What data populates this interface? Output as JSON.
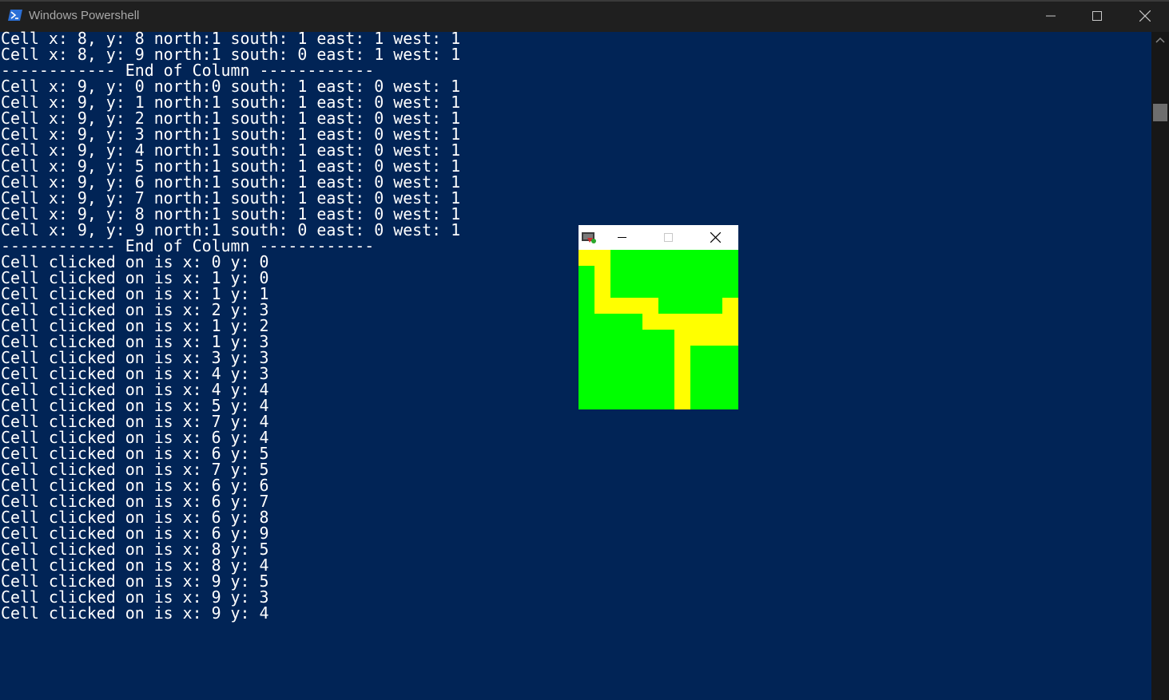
{
  "window": {
    "title": "Windows Powershell"
  },
  "colors": {
    "console_bg": "#012456",
    "console_fg": "#ffffff",
    "maze_wall": "#00ff00",
    "maze_path": "#ffff00"
  },
  "console": {
    "lines": [
      "Cell x: 8, y: 8 north:1 south: 1 east: 1 west: 1",
      "Cell x: 8, y: 9 north:1 south: 0 east: 1 west: 1",
      "------------ End of Column ------------",
      "Cell x: 9, y: 0 north:0 south: 1 east: 0 west: 1",
      "Cell x: 9, y: 1 north:1 south: 1 east: 0 west: 1",
      "Cell x: 9, y: 2 north:1 south: 1 east: 0 west: 1",
      "Cell x: 9, y: 3 north:1 south: 1 east: 0 west: 1",
      "Cell x: 9, y: 4 north:1 south: 1 east: 0 west: 1",
      "Cell x: 9, y: 5 north:1 south: 1 east: 0 west: 1",
      "Cell x: 9, y: 6 north:1 south: 1 east: 0 west: 1",
      "Cell x: 9, y: 7 north:1 south: 1 east: 0 west: 1",
      "Cell x: 9, y: 8 north:1 south: 1 east: 0 west: 1",
      "Cell x: 9, y: 9 north:1 south: 0 east: 0 west: 1",
      "------------ End of Column ------------",
      "Cell clicked on is x: 0 y: 0",
      "Cell clicked on is x: 1 y: 0",
      "Cell clicked on is x: 1 y: 1",
      "Cell clicked on is x: 2 y: 3",
      "Cell clicked on is x: 1 y: 2",
      "Cell clicked on is x: 1 y: 3",
      "Cell clicked on is x: 3 y: 3",
      "Cell clicked on is x: 4 y: 3",
      "Cell clicked on is x: 4 y: 4",
      "Cell clicked on is x: 5 y: 4",
      "Cell clicked on is x: 7 y: 4",
      "Cell clicked on is x: 6 y: 4",
      "Cell clicked on is x: 6 y: 5",
      "Cell clicked on is x: 7 y: 5",
      "Cell clicked on is x: 6 y: 6",
      "Cell clicked on is x: 6 y: 7",
      "Cell clicked on is x: 6 y: 8",
      "Cell clicked on is x: 6 y: 9",
      "Cell clicked on is x: 8 y: 5",
      "Cell clicked on is x: 8 y: 4",
      "Cell clicked on is x: 9 y: 5",
      "Cell clicked on is x: 9 y: 3",
      "Cell clicked on is x: 9 y: 4"
    ]
  },
  "maze": {
    "columns": 10,
    "rows": 10,
    "path_cells": [
      [
        0,
        0
      ],
      [
        1,
        0
      ],
      [
        1,
        1
      ],
      [
        1,
        2
      ],
      [
        1,
        3
      ],
      [
        2,
        3
      ],
      [
        3,
        3
      ],
      [
        4,
        3
      ],
      [
        4,
        4
      ],
      [
        5,
        4
      ],
      [
        6,
        4
      ],
      [
        7,
        4
      ],
      [
        6,
        5
      ],
      [
        7,
        5
      ],
      [
        6,
        6
      ],
      [
        6,
        7
      ],
      [
        6,
        8
      ],
      [
        6,
        9
      ],
      [
        8,
        5
      ],
      [
        8,
        4
      ],
      [
        9,
        5
      ],
      [
        9,
        3
      ],
      [
        9,
        4
      ]
    ]
  }
}
